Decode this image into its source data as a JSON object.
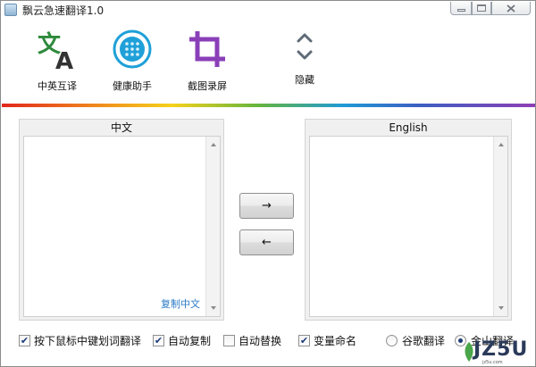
{
  "window": {
    "title": "飘云急速翻译1.0"
  },
  "toolbar": {
    "items": [
      {
        "label": "中英互译",
        "icon": "translate-icon"
      },
      {
        "label": "健康助手",
        "icon": "health-assistant-icon"
      },
      {
        "label": "截图录屏",
        "icon": "crop-screenshot-icon"
      },
      {
        "label": "隐藏",
        "icon": "chevron-collapse-icon"
      }
    ]
  },
  "panels": {
    "source": {
      "header": "中文",
      "text": "",
      "copy_label": "复制中文"
    },
    "target": {
      "header": "English",
      "text": ""
    }
  },
  "buttons": {
    "to_english": "→",
    "to_chinese": "←"
  },
  "options": {
    "middle_click_translate": {
      "label": "按下鼠标中键划词翻译",
      "checked": true
    },
    "auto_copy": {
      "label": "自动复制",
      "checked": true
    },
    "auto_replace": {
      "label": "自动替换",
      "checked": false
    },
    "variable_naming": {
      "label": "变量命名",
      "checked": true
    },
    "engine_google": {
      "label": "谷歌翻译",
      "selected": false
    },
    "engine_kingsoft": {
      "label": "金山翻译",
      "selected": true
    }
  },
  "watermark": {
    "text": "JZ5U",
    "sub": "jz5u.com"
  },
  "colors": {
    "link": "#2a7ac6",
    "rainbow": [
      "#e2261c",
      "#f08a1c",
      "#f6d21c",
      "#64b53c",
      "#1f9ad6",
      "#3b5fc2",
      "#8e3fb6"
    ]
  }
}
